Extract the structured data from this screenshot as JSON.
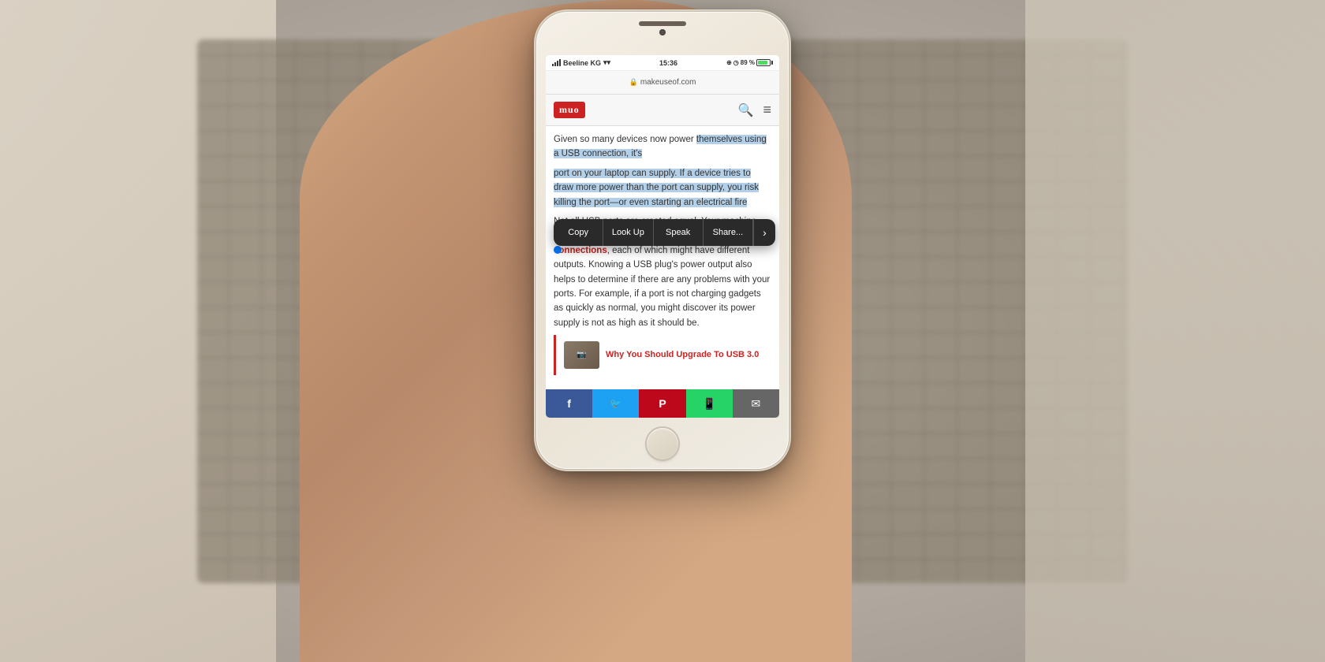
{
  "background": {
    "description": "blurred laptop keyboard and desk scene"
  },
  "phone": {
    "status_bar": {
      "carrier": "Beeline KG",
      "wifi": "wifi",
      "time": "15:36",
      "location_icon": true,
      "alarm_icon": true,
      "battery_percent": "89 %",
      "charging": true
    },
    "browser": {
      "url": "makeuseof.com",
      "logo": "muo",
      "logo_bg": "#cc2222"
    },
    "context_menu": {
      "buttons": [
        "Copy",
        "Look Up",
        "Speak",
        "Share..."
      ]
    },
    "article": {
      "text_above_selection": "Given so many devices now power",
      "selected_line1": "themselves using a USB connection, it's",
      "selected_body": "port on your laptop can supply. If a device tries to draw more power than the port can supply, you risk killing the port—or even starting an electrical fire",
      "paragraph2": "Not all USB ports are created equal. Your machine might have a",
      "link_text": "mix of USB 2.0 and USB 3.0 connections",
      "paragraph2_cont": ", each of which might have different outputs. Knowing a USB plug's power output also helps to determine if there are any problems with your ports. For example, if a port is not charging gadgets as quickly as normal, you might discover its power supply is not as high as it should be.",
      "related_title": "Why You Should Upgrade To USB 3.0"
    },
    "share_bar": {
      "buttons": [
        "facebook",
        "twitter",
        "pinterest",
        "whatsapp",
        "email"
      ]
    }
  }
}
